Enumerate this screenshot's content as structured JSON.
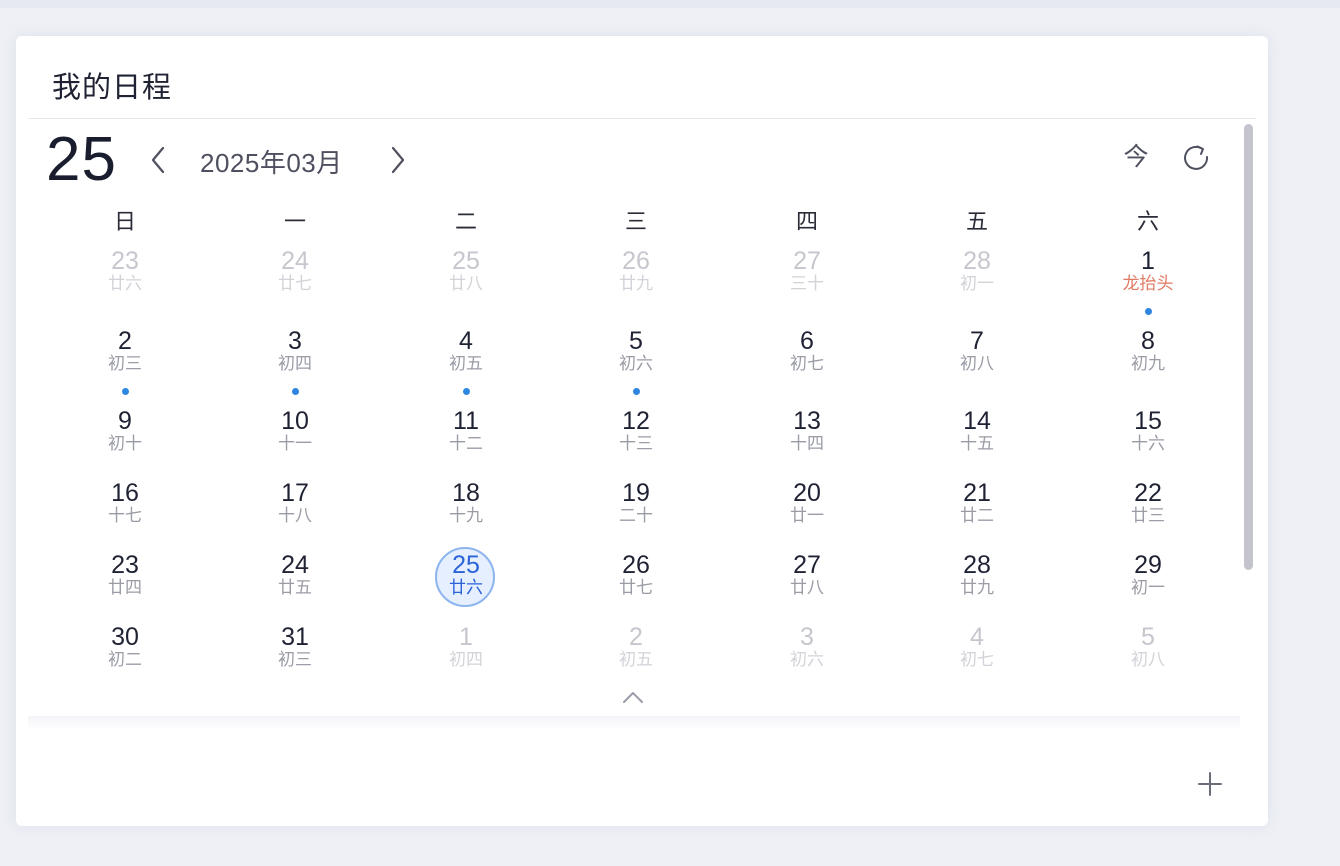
{
  "page": {
    "title": "我的日程"
  },
  "header": {
    "selected_day": "25",
    "month_label": "2025年03月",
    "today_label": "今"
  },
  "weekdays": [
    "日",
    "一",
    "二",
    "三",
    "四",
    "五",
    "六"
  ],
  "calendar": {
    "weeks": [
      [
        {
          "day": "23",
          "lunar": "廿六",
          "other": true
        },
        {
          "day": "24",
          "lunar": "廿七",
          "other": true
        },
        {
          "day": "25",
          "lunar": "廿八",
          "other": true
        },
        {
          "day": "26",
          "lunar": "廿九",
          "other": true
        },
        {
          "day": "27",
          "lunar": "三十",
          "other": true
        },
        {
          "day": "28",
          "lunar": "初一",
          "other": true
        },
        {
          "day": "1",
          "lunar": "龙抬头",
          "festival": true,
          "event": true
        }
      ],
      [
        {
          "day": "2",
          "lunar": "初三",
          "event": true
        },
        {
          "day": "3",
          "lunar": "初四",
          "event": true
        },
        {
          "day": "4",
          "lunar": "初五",
          "event": true
        },
        {
          "day": "5",
          "lunar": "初六",
          "event": true
        },
        {
          "day": "6",
          "lunar": "初七"
        },
        {
          "day": "7",
          "lunar": "初八"
        },
        {
          "day": "8",
          "lunar": "初九"
        }
      ],
      [
        {
          "day": "9",
          "lunar": "初十"
        },
        {
          "day": "10",
          "lunar": "十一"
        },
        {
          "day": "11",
          "lunar": "十二"
        },
        {
          "day": "12",
          "lunar": "十三"
        },
        {
          "day": "13",
          "lunar": "十四"
        },
        {
          "day": "14",
          "lunar": "十五"
        },
        {
          "day": "15",
          "lunar": "十六"
        }
      ],
      [
        {
          "day": "16",
          "lunar": "十七"
        },
        {
          "day": "17",
          "lunar": "十八"
        },
        {
          "day": "18",
          "lunar": "十九"
        },
        {
          "day": "19",
          "lunar": "二十"
        },
        {
          "day": "20",
          "lunar": "廿一"
        },
        {
          "day": "21",
          "lunar": "廿二"
        },
        {
          "day": "22",
          "lunar": "廿三"
        }
      ],
      [
        {
          "day": "23",
          "lunar": "廿四"
        },
        {
          "day": "24",
          "lunar": "廿五"
        },
        {
          "day": "25",
          "lunar": "廿六",
          "today": true
        },
        {
          "day": "26",
          "lunar": "廿七"
        },
        {
          "day": "27",
          "lunar": "廿八"
        },
        {
          "day": "28",
          "lunar": "廿九"
        },
        {
          "day": "29",
          "lunar": "初一"
        }
      ],
      [
        {
          "day": "30",
          "lunar": "初二"
        },
        {
          "day": "31",
          "lunar": "初三"
        },
        {
          "day": "1",
          "lunar": "初四",
          "other": true
        },
        {
          "day": "2",
          "lunar": "初五",
          "other": true
        },
        {
          "day": "3",
          "lunar": "初六",
          "other": true
        },
        {
          "day": "4",
          "lunar": "初七",
          "other": true
        },
        {
          "day": "5",
          "lunar": "初八",
          "other": true
        }
      ]
    ]
  },
  "icons": {
    "prev": "chevron-left-icon",
    "next": "chevron-right-icon",
    "refresh": "refresh-icon",
    "collapse": "chevron-up-icon",
    "add": "plus-icon"
  },
  "colors": {
    "accent": "#2a62d8",
    "event_dot": "#2d86e0",
    "festival": "#e17a63",
    "today_ring": "#8cb4ee",
    "today_fill": "#e6efff"
  }
}
